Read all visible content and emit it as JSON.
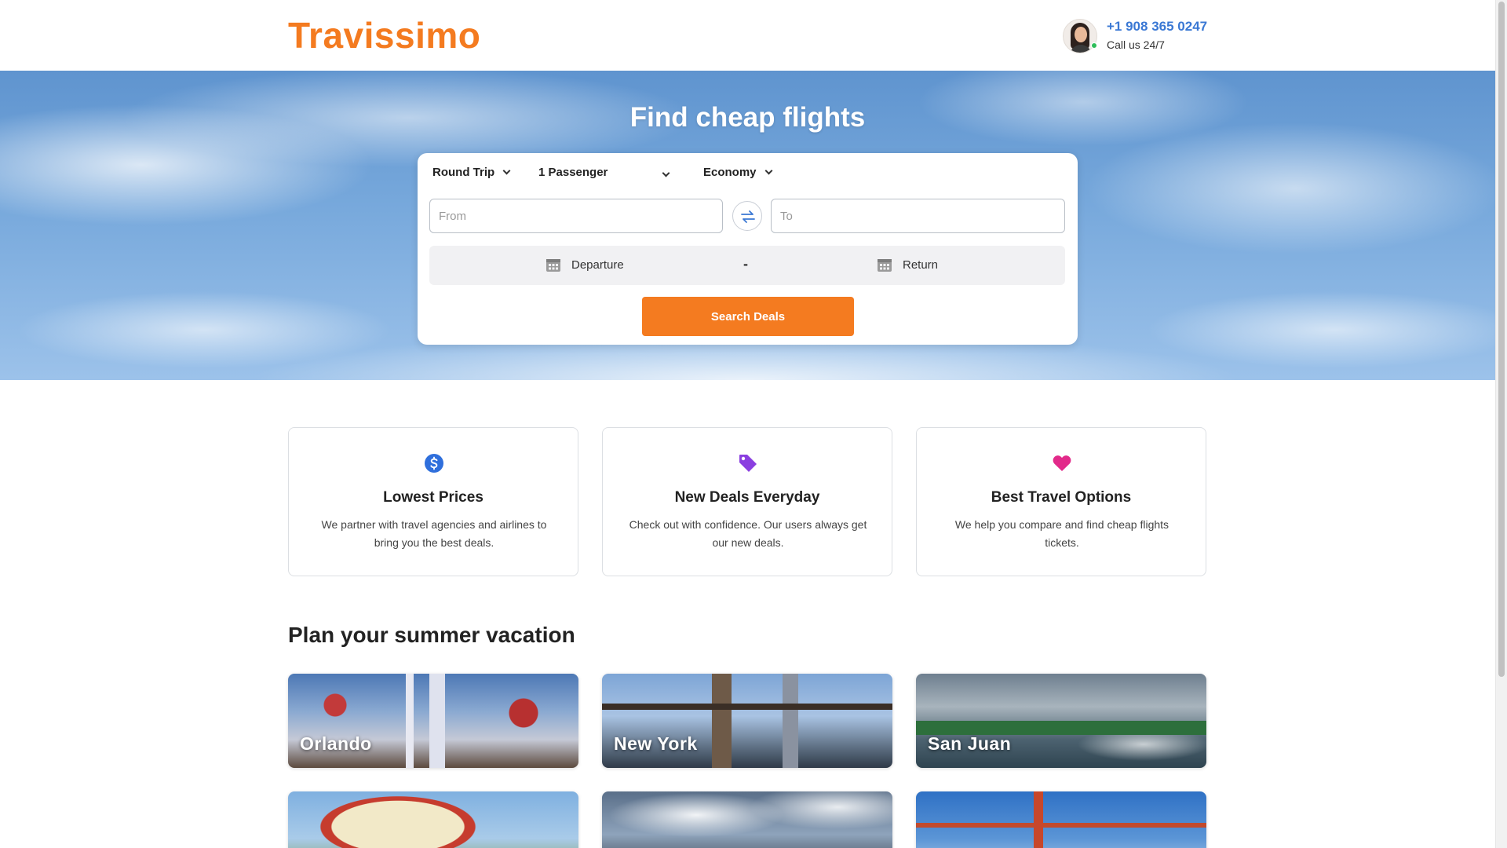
{
  "header": {
    "logo": "Travissimo",
    "phone": "+1 908 365 0247",
    "call_label": "Call us 24/7"
  },
  "hero": {
    "title": "Find cheap flights"
  },
  "search": {
    "trip_type": "Round Trip",
    "passengers": "1 Passenger",
    "cabin_class": "Economy",
    "from_placeholder": "From",
    "to_placeholder": "To",
    "departure_label": "Departure",
    "date_separator": "-",
    "return_label": "Return",
    "button_label": "Search Deals"
  },
  "features": [
    {
      "icon": "dollar-icon",
      "color": "#2f6fdc",
      "title": "Lowest Prices",
      "text": "We partner with travel agencies and airlines to bring you the best deals."
    },
    {
      "icon": "tag-icon",
      "color": "#8a3fe0",
      "title": "New Deals Everyday",
      "text": "Check out with confidence. Our users always get our new deals."
    },
    {
      "icon": "heart-icon",
      "color": "#e22a8a",
      "title": "Best Travel Options",
      "text": "We help you compare and find cheap flights tickets."
    }
  ],
  "destinations": {
    "title": "Plan your summer vacation",
    "items": [
      {
        "name": "Orlando"
      },
      {
        "name": "New York"
      },
      {
        "name": "San Juan"
      },
      {
        "name": ""
      },
      {
        "name": ""
      },
      {
        "name": ""
      }
    ]
  },
  "colors": {
    "brand": "#f47b20",
    "phone": "#3a78d4"
  }
}
